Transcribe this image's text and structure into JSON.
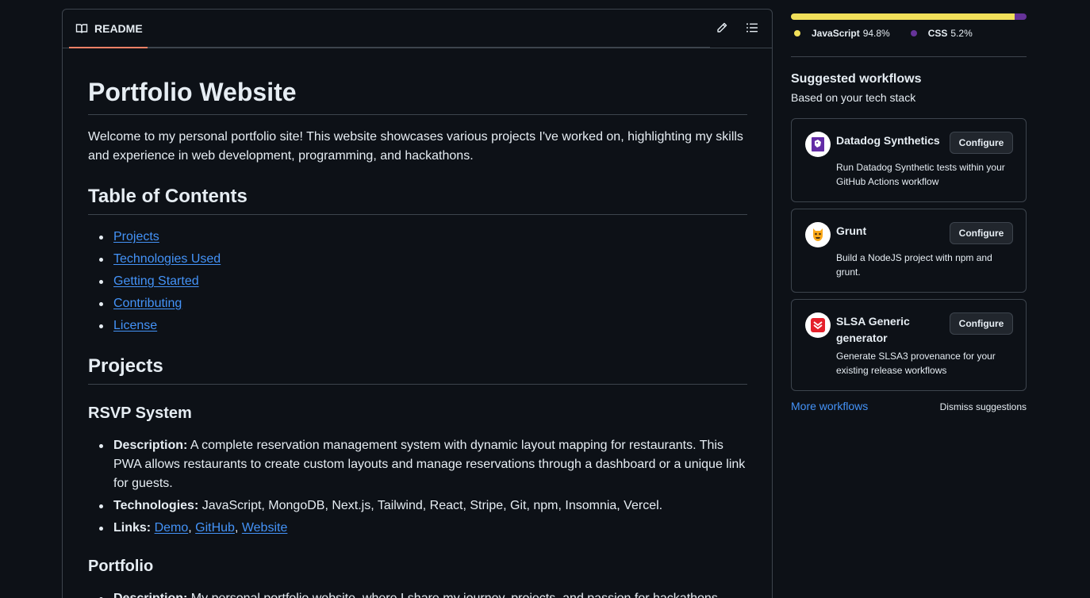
{
  "readme": {
    "tab_label": "README",
    "title": "Portfolio Website",
    "intro": "Welcome to my personal portfolio site! This website showcases various projects I've worked on, highlighting my skills and experience in web development, programming, and hackathons.",
    "toc_heading": "Table of Contents",
    "toc": [
      "Projects",
      "Technologies Used",
      "Getting Started",
      "Contributing",
      "License"
    ],
    "projects_heading": "Projects",
    "rsvp": {
      "heading": "RSVP System",
      "desc_label": "Description:",
      "desc": " A complete reservation management system with dynamic layout mapping for restaurants. This PWA allows restaurants to create custom layouts and manage reservations through a dashboard or a unique link for guests.",
      "tech_label": "Technologies:",
      "tech": " JavaScript, MongoDB, Next.js, Tailwind, React, Stripe, Git, npm, Insomnia, Vercel.",
      "links_label": "Links:",
      "links": [
        "Demo",
        "GitHub",
        "Website"
      ],
      "link_sep": ", "
    },
    "portfolio": {
      "heading": "Portfolio",
      "desc_label": "Description:",
      "desc": " My personal portfolio website, where I share my journey, projects, and passion for hackathons."
    }
  },
  "languages": [
    {
      "name": "JavaScript",
      "percent": "94.8%",
      "fraction": 0.948,
      "color": "#f1e05a"
    },
    {
      "name": "CSS",
      "percent": "5.2%",
      "fraction": 0.052,
      "color": "#663399"
    }
  ],
  "suggested": {
    "title": "Suggested workflows",
    "subtitle": "Based on your tech stack",
    "configure_label": "Configure",
    "workflows": [
      {
        "name": "Datadog Synthetics",
        "description": "Run Datadog Synthetic tests within your GitHub Actions workflow",
        "icon": "datadog-icon"
      },
      {
        "name": "Grunt",
        "description": "Build a NodeJS project with npm and grunt.",
        "icon": "grunt-icon"
      },
      {
        "name": "SLSA Generic generator",
        "description": "Generate SLSA3 provenance for your existing release workflows",
        "icon": "slsa-icon"
      }
    ],
    "more_label": "More workflows",
    "dismiss_label": "Dismiss suggestions"
  },
  "colors": {
    "accent_link": "#4493f8",
    "tab_underline": "#f78166",
    "background": "#0d1117",
    "border": "#3d444d"
  }
}
